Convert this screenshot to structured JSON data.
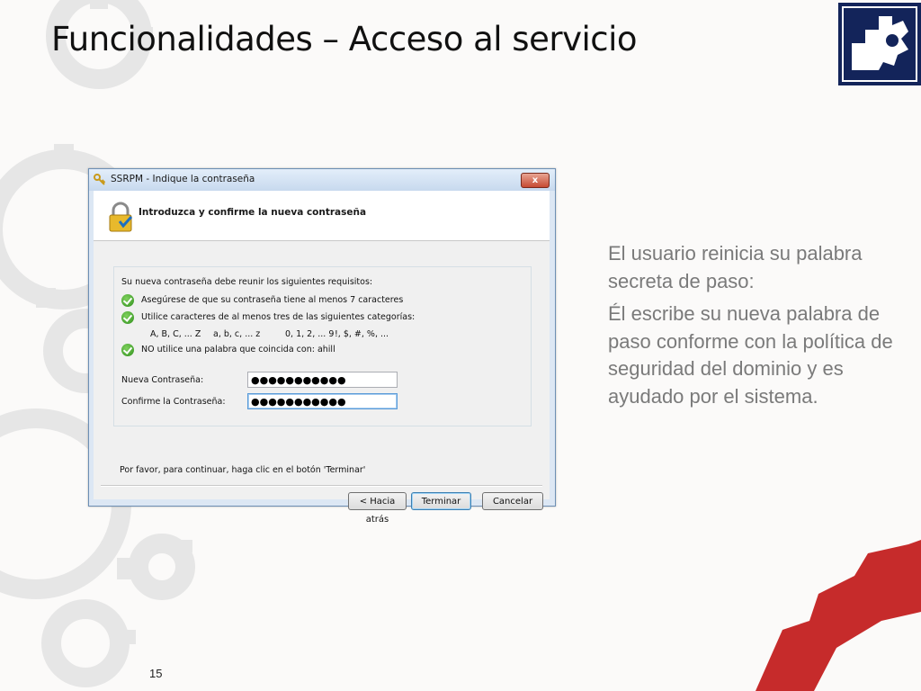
{
  "slide": {
    "title": "Funcionalidades – Acceso al servicio",
    "page_number": "15",
    "body_paragraphs": [
      "El usuario reinicia su palabra secreta de paso:",
      "Él escribe su nueva palabra de paso conforme con la política de seguridad del dominio y es ayudado por el sistema."
    ],
    "colors": {
      "accent_red": "#c62b2b",
      "logo_navy": "#13245a",
      "gear_gray": "#e3e3e3",
      "text_gray": "#7a7a7a"
    }
  },
  "dialog": {
    "window_title": "SSRPM - Indique la contraseña",
    "close_label": "x",
    "header_title": "Introduzca y confirme la nueva contraseña",
    "requirements_title": "Su nueva contraseña debe reunir los siguientes requisitos:",
    "requirements": [
      "Asegúrese de que su contraseña tiene al menos 7 caracteres",
      "Utilice caracteres de al menos tres de las siguientes categorías:",
      "NO utilice una palabra que coincida con: ahill"
    ],
    "categories": [
      "A, B, C, ... Z",
      "a, b, c, ... z",
      "0, 1, 2, ... 9",
      "!, $, #, %, ..."
    ],
    "new_password_label": "Nueva Contraseña:",
    "new_password_value": "●●●●●●●●●●●",
    "confirm_password_label": "Confirme la Contraseña:",
    "confirm_password_value": "●●●●●●●●●●●",
    "footer_text": "Por favor, para continuar, haga clic en el botón 'Terminar'",
    "buttons": {
      "back": "< Hacia atrás",
      "finish": "Terminar",
      "cancel": "Cancelar"
    }
  }
}
